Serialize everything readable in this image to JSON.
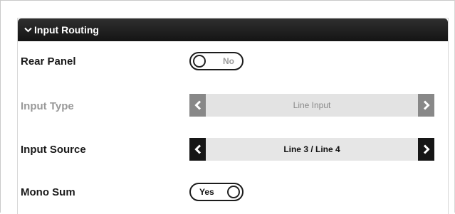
{
  "section": {
    "title": "Input Routing",
    "collapse_icon": "chevron-down-icon"
  },
  "rows": {
    "rear_panel": {
      "label": "Rear Panel",
      "toggle_text": "No",
      "state": "off"
    },
    "input_type": {
      "label": "Input Type",
      "value": "Line Input",
      "enabled": false,
      "prev_icon": "chevron-left-icon",
      "next_icon": "chevron-right-icon"
    },
    "input_source": {
      "label": "Input Source",
      "value": "Line 3 / Line 4",
      "enabled": true,
      "prev_icon": "chevron-left-icon",
      "next_icon": "chevron-right-icon"
    },
    "mono_sum": {
      "label": "Mono Sum",
      "toggle_text": "Yes",
      "state": "on"
    }
  },
  "colors": {
    "header_bg": "#1a1a1a",
    "disabled_text": "#999999",
    "disabled_arrow_bg": "#888888",
    "enabled_arrow_bg": "#161616",
    "selector_bg": "#e3e3e3"
  }
}
